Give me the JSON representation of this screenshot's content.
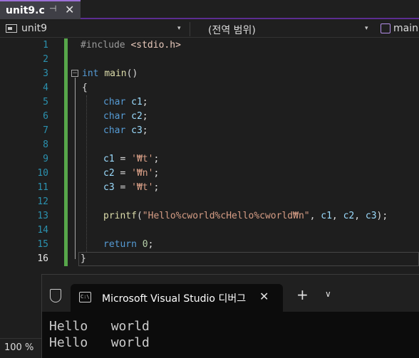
{
  "tab": {
    "title": "unit9.c",
    "pin_glyph": "⊣",
    "close_glyph": "✕"
  },
  "nav": {
    "project": "unit9",
    "scope": "(전역 범위)",
    "member": "main",
    "dropdown_glyph": "▾"
  },
  "editor": {
    "line_numbers": [
      "1",
      "2",
      "3",
      "4",
      "5",
      "6",
      "7",
      "8",
      "9",
      "10",
      "11",
      "12",
      "13",
      "14",
      "15",
      "16"
    ],
    "current_line": "16",
    "fold_glyph": "−"
  },
  "code": {
    "l1_pp": "#include ",
    "l1_inc": "<stdio.h>",
    "l3_kw": "int",
    "l3_fn": "main",
    "l3_rest": "()",
    "l4": "{",
    "l5_kw": "char",
    "l5_var": "c1",
    "l6_kw": "char",
    "l6_var": "c2",
    "l7_kw": "char",
    "l7_var": "c3",
    "l9_var": "c1",
    "l9_str": "'₩t'",
    "l10_var": "c2",
    "l10_str": "'₩n'",
    "l11_var": "c3",
    "l11_str": "'₩t'",
    "l13_fn": "printf",
    "l13_str": "\"Hello%cworld%cHello%cworld₩n\"",
    "l13_a1": "c1",
    "l13_a2": "c2",
    "l13_a3": "c3",
    "l15_kw": "return",
    "l15_num": "0",
    "l16": "}",
    "eq": " = ",
    "semi": ";",
    "comma": ", ",
    "open_paren": "(",
    "close_paren_semi": ");"
  },
  "terminal": {
    "tab_title": "Microsoft Visual Studio 디버그",
    "tab_icon_text": "C:\\",
    "close_glyph": "✕",
    "plus_glyph": "+",
    "chevron_glyph": "∨",
    "output": [
      "Hello   world",
      "Hello   world"
    ]
  },
  "zoom": {
    "level": "100 %"
  },
  "colors": {
    "accent": "#9b6fd6",
    "keyword": "#569cd6",
    "string": "#d69d85",
    "function": "#dcdcaa",
    "variable": "#9cdcfe",
    "line_number": "#2b91af",
    "change_bar": "#57a64a"
  }
}
